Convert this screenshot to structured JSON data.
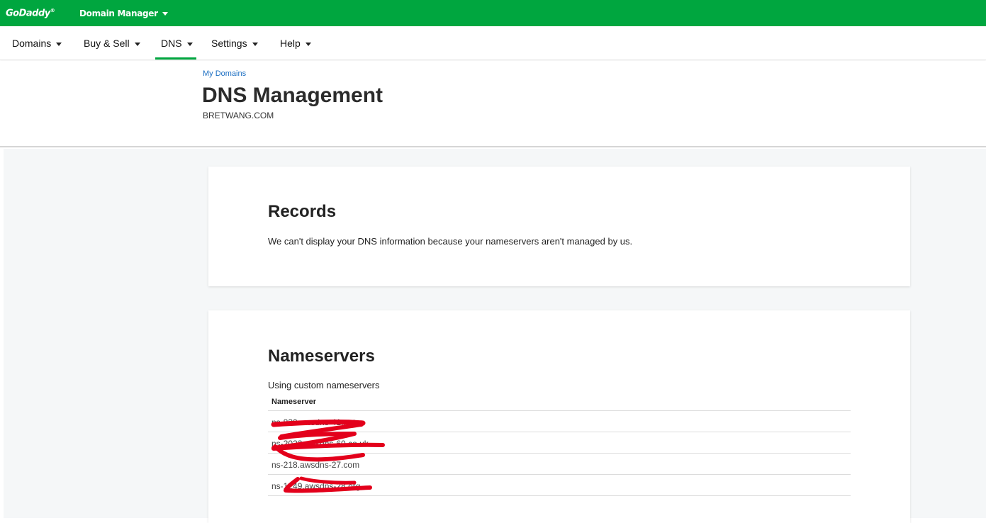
{
  "topbar": {
    "brand": "GoDaddy",
    "app_name": "Domain Manager"
  },
  "nav": {
    "items": [
      {
        "label": "Domains"
      },
      {
        "label": "Buy & Sell"
      },
      {
        "label": "DNS"
      },
      {
        "label": "Settings"
      },
      {
        "label": "Help"
      }
    ],
    "active": "DNS"
  },
  "header": {
    "breadcrumb": "My Domains",
    "title": "DNS Management",
    "domain": "BRETWANG.COM"
  },
  "records": {
    "title": "Records",
    "message": "We can't display your DNS information because your nameservers aren't managed by us."
  },
  "nameservers": {
    "title": "Nameservers",
    "subtitle": "Using custom nameservers",
    "column_header": "Nameserver",
    "rows": [
      "ns-830.awsdns-41.net",
      "ns-2023.awsdns-60.co.uk",
      "ns-218.awsdns-27.com",
      "ns-1249.awsdns-28.org"
    ]
  },
  "colors": {
    "brand_green": "#00a63f",
    "link_blue": "#1b6ec2",
    "redaction_red": "#e3001b"
  }
}
